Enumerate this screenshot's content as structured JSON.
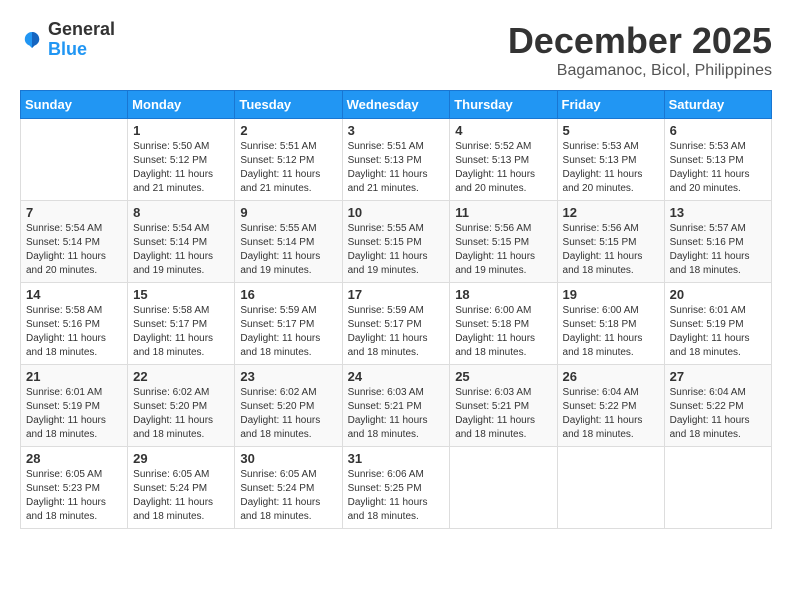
{
  "logo": {
    "general": "General",
    "blue": "Blue"
  },
  "title": "December 2025",
  "location": "Bagamanoc, Bicol, Philippines",
  "weekdays": [
    "Sunday",
    "Monday",
    "Tuesday",
    "Wednesday",
    "Thursday",
    "Friday",
    "Saturday"
  ],
  "weeks": [
    [
      {
        "day": "",
        "info": ""
      },
      {
        "day": "1",
        "info": "Sunrise: 5:50 AM\nSunset: 5:12 PM\nDaylight: 11 hours and 21 minutes."
      },
      {
        "day": "2",
        "info": "Sunrise: 5:51 AM\nSunset: 5:12 PM\nDaylight: 11 hours and 21 minutes."
      },
      {
        "day": "3",
        "info": "Sunrise: 5:51 AM\nSunset: 5:13 PM\nDaylight: 11 hours and 21 minutes."
      },
      {
        "day": "4",
        "info": "Sunrise: 5:52 AM\nSunset: 5:13 PM\nDaylight: 11 hours and 20 minutes."
      },
      {
        "day": "5",
        "info": "Sunrise: 5:53 AM\nSunset: 5:13 PM\nDaylight: 11 hours and 20 minutes."
      },
      {
        "day": "6",
        "info": "Sunrise: 5:53 AM\nSunset: 5:13 PM\nDaylight: 11 hours and 20 minutes."
      }
    ],
    [
      {
        "day": "7",
        "info": "Sunrise: 5:54 AM\nSunset: 5:14 PM\nDaylight: 11 hours and 20 minutes."
      },
      {
        "day": "8",
        "info": "Sunrise: 5:54 AM\nSunset: 5:14 PM\nDaylight: 11 hours and 19 minutes."
      },
      {
        "day": "9",
        "info": "Sunrise: 5:55 AM\nSunset: 5:14 PM\nDaylight: 11 hours and 19 minutes."
      },
      {
        "day": "10",
        "info": "Sunrise: 5:55 AM\nSunset: 5:15 PM\nDaylight: 11 hours and 19 minutes."
      },
      {
        "day": "11",
        "info": "Sunrise: 5:56 AM\nSunset: 5:15 PM\nDaylight: 11 hours and 19 minutes."
      },
      {
        "day": "12",
        "info": "Sunrise: 5:56 AM\nSunset: 5:15 PM\nDaylight: 11 hours and 18 minutes."
      },
      {
        "day": "13",
        "info": "Sunrise: 5:57 AM\nSunset: 5:16 PM\nDaylight: 11 hours and 18 minutes."
      }
    ],
    [
      {
        "day": "14",
        "info": "Sunrise: 5:58 AM\nSunset: 5:16 PM\nDaylight: 11 hours and 18 minutes."
      },
      {
        "day": "15",
        "info": "Sunrise: 5:58 AM\nSunset: 5:17 PM\nDaylight: 11 hours and 18 minutes."
      },
      {
        "day": "16",
        "info": "Sunrise: 5:59 AM\nSunset: 5:17 PM\nDaylight: 11 hours and 18 minutes."
      },
      {
        "day": "17",
        "info": "Sunrise: 5:59 AM\nSunset: 5:17 PM\nDaylight: 11 hours and 18 minutes."
      },
      {
        "day": "18",
        "info": "Sunrise: 6:00 AM\nSunset: 5:18 PM\nDaylight: 11 hours and 18 minutes."
      },
      {
        "day": "19",
        "info": "Sunrise: 6:00 AM\nSunset: 5:18 PM\nDaylight: 11 hours and 18 minutes."
      },
      {
        "day": "20",
        "info": "Sunrise: 6:01 AM\nSunset: 5:19 PM\nDaylight: 11 hours and 18 minutes."
      }
    ],
    [
      {
        "day": "21",
        "info": "Sunrise: 6:01 AM\nSunset: 5:19 PM\nDaylight: 11 hours and 18 minutes."
      },
      {
        "day": "22",
        "info": "Sunrise: 6:02 AM\nSunset: 5:20 PM\nDaylight: 11 hours and 18 minutes."
      },
      {
        "day": "23",
        "info": "Sunrise: 6:02 AM\nSunset: 5:20 PM\nDaylight: 11 hours and 18 minutes."
      },
      {
        "day": "24",
        "info": "Sunrise: 6:03 AM\nSunset: 5:21 PM\nDaylight: 11 hours and 18 minutes."
      },
      {
        "day": "25",
        "info": "Sunrise: 6:03 AM\nSunset: 5:21 PM\nDaylight: 11 hours and 18 minutes."
      },
      {
        "day": "26",
        "info": "Sunrise: 6:04 AM\nSunset: 5:22 PM\nDaylight: 11 hours and 18 minutes."
      },
      {
        "day": "27",
        "info": "Sunrise: 6:04 AM\nSunset: 5:22 PM\nDaylight: 11 hours and 18 minutes."
      }
    ],
    [
      {
        "day": "28",
        "info": "Sunrise: 6:05 AM\nSunset: 5:23 PM\nDaylight: 11 hours and 18 minutes."
      },
      {
        "day": "29",
        "info": "Sunrise: 6:05 AM\nSunset: 5:24 PM\nDaylight: 11 hours and 18 minutes."
      },
      {
        "day": "30",
        "info": "Sunrise: 6:05 AM\nSunset: 5:24 PM\nDaylight: 11 hours and 18 minutes."
      },
      {
        "day": "31",
        "info": "Sunrise: 6:06 AM\nSunset: 5:25 PM\nDaylight: 11 hours and 18 minutes."
      },
      {
        "day": "",
        "info": ""
      },
      {
        "day": "",
        "info": ""
      },
      {
        "day": "",
        "info": ""
      }
    ]
  ]
}
